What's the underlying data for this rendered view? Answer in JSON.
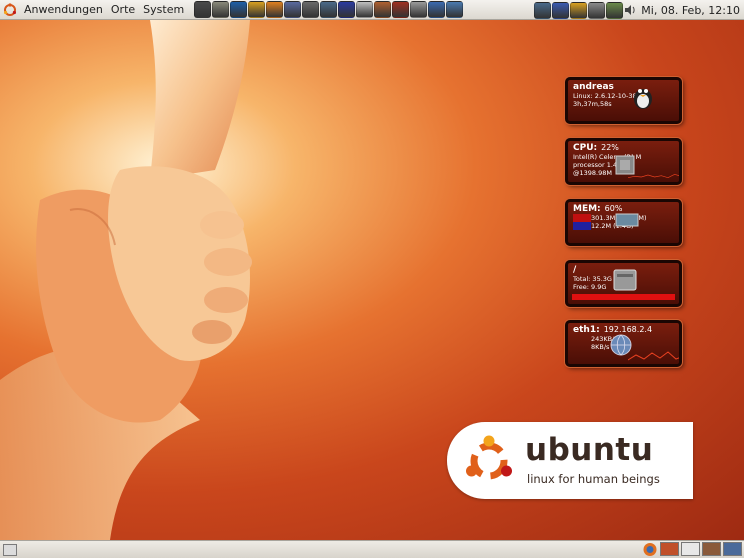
{
  "top_panel": {
    "menus": [
      "Anwendungen",
      "Orte",
      "System"
    ],
    "launchers": [
      {
        "icon": "terminal-icon",
        "color": "#4a4a4a"
      },
      {
        "icon": "file-manager-icon",
        "color": "#8a8a7a"
      },
      {
        "icon": "web-browser-icon",
        "color": "#1d5fa8"
      },
      {
        "icon": "user-icon",
        "color": "#d8a020"
      },
      {
        "icon": "skype-icon",
        "color": "#e08020"
      },
      {
        "icon": "document-icon",
        "color": "#5a6aa0"
      },
      {
        "icon": "printer-icon",
        "color": "#6a6a6a"
      },
      {
        "icon": "network-icon",
        "color": "#4a6a8a"
      },
      {
        "icon": "settings-icon",
        "color": "#2a3aa0"
      },
      {
        "icon": "help-icon",
        "color": "#c0c0c0"
      },
      {
        "icon": "package-icon",
        "color": "#b06030"
      },
      {
        "icon": "tools-icon",
        "color": "#a03020"
      },
      {
        "icon": "cd-icon",
        "color": "#9a9a9a"
      },
      {
        "icon": "globe-icon",
        "color": "#3a6ab0"
      },
      {
        "icon": "mail-icon",
        "color": "#4a7ab0"
      }
    ],
    "tray": [
      {
        "icon": "network-status-icon",
        "color": "#4a6a8a"
      },
      {
        "icon": "update-icon",
        "color": "#3a5ab0"
      },
      {
        "icon": "user-switch-icon",
        "color": "#d8a020"
      },
      {
        "icon": "power-icon",
        "color": "#8a8a8a"
      },
      {
        "icon": "battery-icon",
        "color": "#6a8a4a"
      }
    ],
    "volume_icon": "volume-icon",
    "clock": "Mi, 08. Feb, 12:10"
  },
  "widgets": {
    "user": {
      "title": "andreas",
      "lines": [
        "Linux: 2.6.12-10-386",
        "3h,37m,58s"
      ]
    },
    "cpu": {
      "title": "CPU:",
      "percent": "22%",
      "lines": [
        "Intel(R) Celeron(R) M",
        "processor        1.40GHz",
        "@1398.98M"
      ]
    },
    "mem": {
      "title": "MEM:",
      "percent": "60%",
      "lines": [
        "301.3M (495.8M)",
        "12.2M (1.4G)"
      ]
    },
    "disk": {
      "title": "/",
      "lines": [
        "Total: 35.3G",
        "Free: 9.9G"
      ]
    },
    "net": {
      "title": "eth1:",
      "ip": "192.168.2.4",
      "lines": [
        "243KB/s",
        "8KB/s"
      ]
    }
  },
  "branding": {
    "wordmark": "ubuntu",
    "tagline": "linux for human beings",
    "colors": {
      "orange": "#e0601a",
      "yellow": "#f3a41c",
      "red": "#c01818",
      "text": "#3a2a22"
    }
  },
  "bottom_panel": {
    "workspaces": [
      {
        "name": "workspace-1",
        "color": "#c0502a"
      },
      {
        "name": "workspace-2",
        "color": "#e8e8e8"
      },
      {
        "name": "workspace-3",
        "color": "#8a5a3a"
      },
      {
        "name": "workspace-4",
        "color": "#4a6a9a"
      }
    ]
  }
}
